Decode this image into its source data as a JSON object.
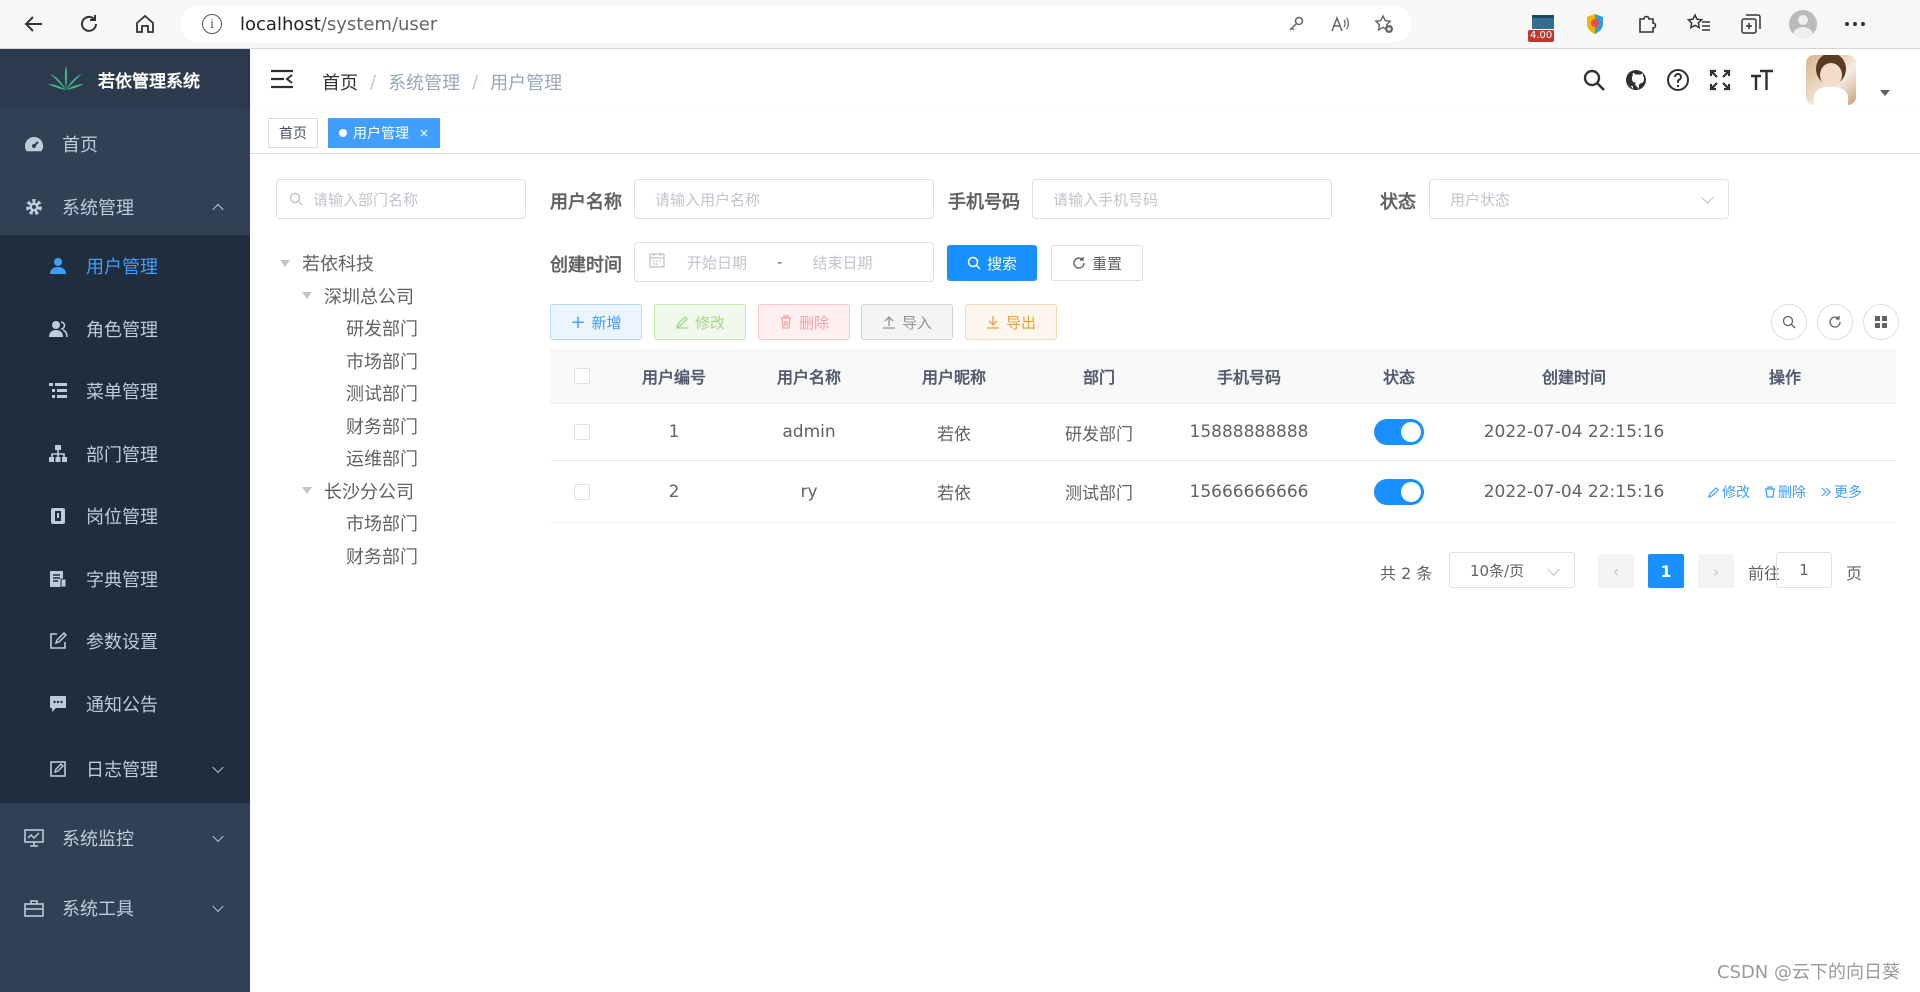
{
  "browser": {
    "url_host": "localhost",
    "url_path": "/system/user",
    "ext_badge": "4.00"
  },
  "sidebar": {
    "title": "若依管理系统",
    "items": [
      {
        "label": "首页"
      },
      {
        "label": "系统管理"
      },
      {
        "label": "系统监控"
      },
      {
        "label": "系统工具"
      }
    ],
    "sub_items": [
      {
        "label": "用户管理"
      },
      {
        "label": "角色管理"
      },
      {
        "label": "菜单管理"
      },
      {
        "label": "部门管理"
      },
      {
        "label": "岗位管理"
      },
      {
        "label": "字典管理"
      },
      {
        "label": "参数设置"
      },
      {
        "label": "通知公告"
      },
      {
        "label": "日志管理"
      }
    ]
  },
  "navbar": {
    "breadcrumb": [
      "首页",
      "系统管理",
      "用户管理"
    ],
    "breadcrumb_sep": "/"
  },
  "tags": {
    "home": "首页",
    "active": "用户管理",
    "close": "×"
  },
  "dept_tree": {
    "search_placeholder": "请输入部门名称",
    "root": "若依科技",
    "nodes": [
      "深圳总公司",
      "研发部门",
      "市场部门",
      "测试部门",
      "财务部门",
      "运维部门",
      "长沙分公司",
      "市场部门",
      "财务部门"
    ]
  },
  "filters": {
    "username_label": "用户名称",
    "username_placeholder": "请输入用户名称",
    "phone_label": "手机号码",
    "phone_placeholder": "请输入手机号码",
    "status_label": "状态",
    "status_placeholder": "用户状态",
    "created_label": "创建时间",
    "start_placeholder": "开始日期",
    "range_sep": "-",
    "end_placeholder": "结束日期",
    "search_btn": "搜索",
    "reset_btn": "重置"
  },
  "toolbar": {
    "add": "新增",
    "edit": "修改",
    "delete": "删除",
    "import": "导入",
    "export": "导出"
  },
  "table": {
    "headers": [
      "用户编号",
      "用户名称",
      "用户昵称",
      "部门",
      "手机号码",
      "状态",
      "创建时间",
      "操作"
    ],
    "rows": [
      {
        "id": "1",
        "username": "admin",
        "nickname": "若依",
        "dept": "研发部门",
        "phone": "15888888888",
        "status_on": true,
        "created": "2022-07-04 22:15:16"
      },
      {
        "id": "2",
        "username": "ry",
        "nickname": "若依",
        "dept": "测试部门",
        "phone": "15666666666",
        "status_on": true,
        "created": "2022-07-04 22:15:16"
      }
    ],
    "ops": {
      "edit": "修改",
      "delete": "删除",
      "more": "更多"
    }
  },
  "pagination": {
    "total": "共 2 条",
    "page_size": "10条/页",
    "current_page": "1",
    "goto_label": "前往",
    "goto_value": "1",
    "page_suffix": "页"
  },
  "watermark": "CSDN @云下的向日葵",
  "colors": {
    "sidebar": "#304156",
    "primary": "#1890ff",
    "active_menu": "#409eff"
  }
}
